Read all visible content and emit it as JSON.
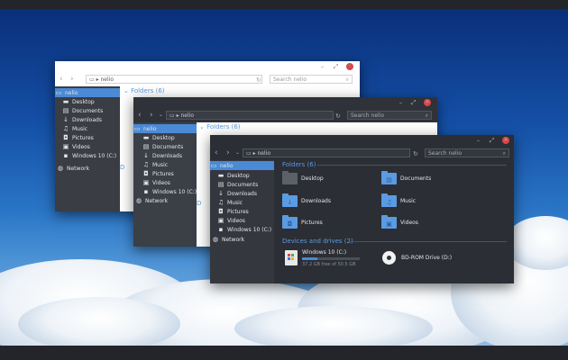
{
  "win1": {
    "address": "nelio",
    "search_placeholder": "Search nelio",
    "section_folders": "Folders (6)",
    "section_devices": "D",
    "nav": [
      {
        "icon": "monitor",
        "label": "nelio"
      },
      {
        "icon": "folder",
        "label": "Desktop"
      },
      {
        "icon": "document",
        "label": "Documents"
      },
      {
        "icon": "download",
        "label": "Downloads"
      },
      {
        "icon": "music",
        "label": "Music"
      },
      {
        "icon": "camera",
        "label": "Pictures"
      },
      {
        "icon": "film",
        "label": "Videos"
      },
      {
        "icon": "drive",
        "label": "Windows 10 (C:)"
      },
      {
        "icon": "network",
        "label": "Network"
      }
    ]
  },
  "win2": {
    "address": "nelio",
    "search_placeholder": "Search nelio",
    "section_folders": "Folders (6)",
    "section_devices": "D",
    "nav": [
      {
        "icon": "monitor",
        "label": "nelio"
      },
      {
        "icon": "folder",
        "label": "Desktop"
      },
      {
        "icon": "document",
        "label": "Documents"
      },
      {
        "icon": "download",
        "label": "Downloads"
      },
      {
        "icon": "music",
        "label": "Music"
      },
      {
        "icon": "camera",
        "label": "Pictures"
      },
      {
        "icon": "film",
        "label": "Videos"
      },
      {
        "icon": "drive",
        "label": "Windows 10 (C:)"
      },
      {
        "icon": "network",
        "label": "Network"
      }
    ]
  },
  "win3": {
    "address": "nelio",
    "search_placeholder": "Search nelio",
    "section_folders": "Folders (6)",
    "section_devices": "Devices and drives (2)",
    "nav": [
      {
        "icon": "monitor",
        "label": "nelio"
      },
      {
        "icon": "folder",
        "label": "Desktop"
      },
      {
        "icon": "document",
        "label": "Documents"
      },
      {
        "icon": "download",
        "label": "Downloads"
      },
      {
        "icon": "music",
        "label": "Music"
      },
      {
        "icon": "camera",
        "label": "Pictures"
      },
      {
        "icon": "film",
        "label": "Videos"
      },
      {
        "icon": "drive",
        "label": "Windows 10 (C:)"
      },
      {
        "icon": "network",
        "label": "Network"
      }
    ],
    "folders": [
      {
        "label": "Desktop",
        "icon": "folder"
      },
      {
        "label": "Documents",
        "icon": "folder-document"
      },
      {
        "label": "Downloads",
        "icon": "folder-download"
      },
      {
        "label": "Music",
        "icon": "folder-music"
      },
      {
        "label": "Pictures",
        "icon": "folder-pictures"
      },
      {
        "label": "Videos",
        "icon": "folder-videos"
      }
    ],
    "drives": [
      {
        "label": "Windows 10 (C:)",
        "free_text": "37.2 GB free of 50.5 GB",
        "used_fraction": 0.26,
        "icon": "windows-drive"
      },
      {
        "label": "BD-ROM Drive (D:)",
        "icon": "disc-drive"
      }
    ]
  },
  "colors": {
    "accent": "#4a8ad6",
    "dark_bg": "#2b2e34",
    "sidebar_bg": "#34373e",
    "close": "#e04343",
    "folder_blue": "#5b9be2"
  }
}
